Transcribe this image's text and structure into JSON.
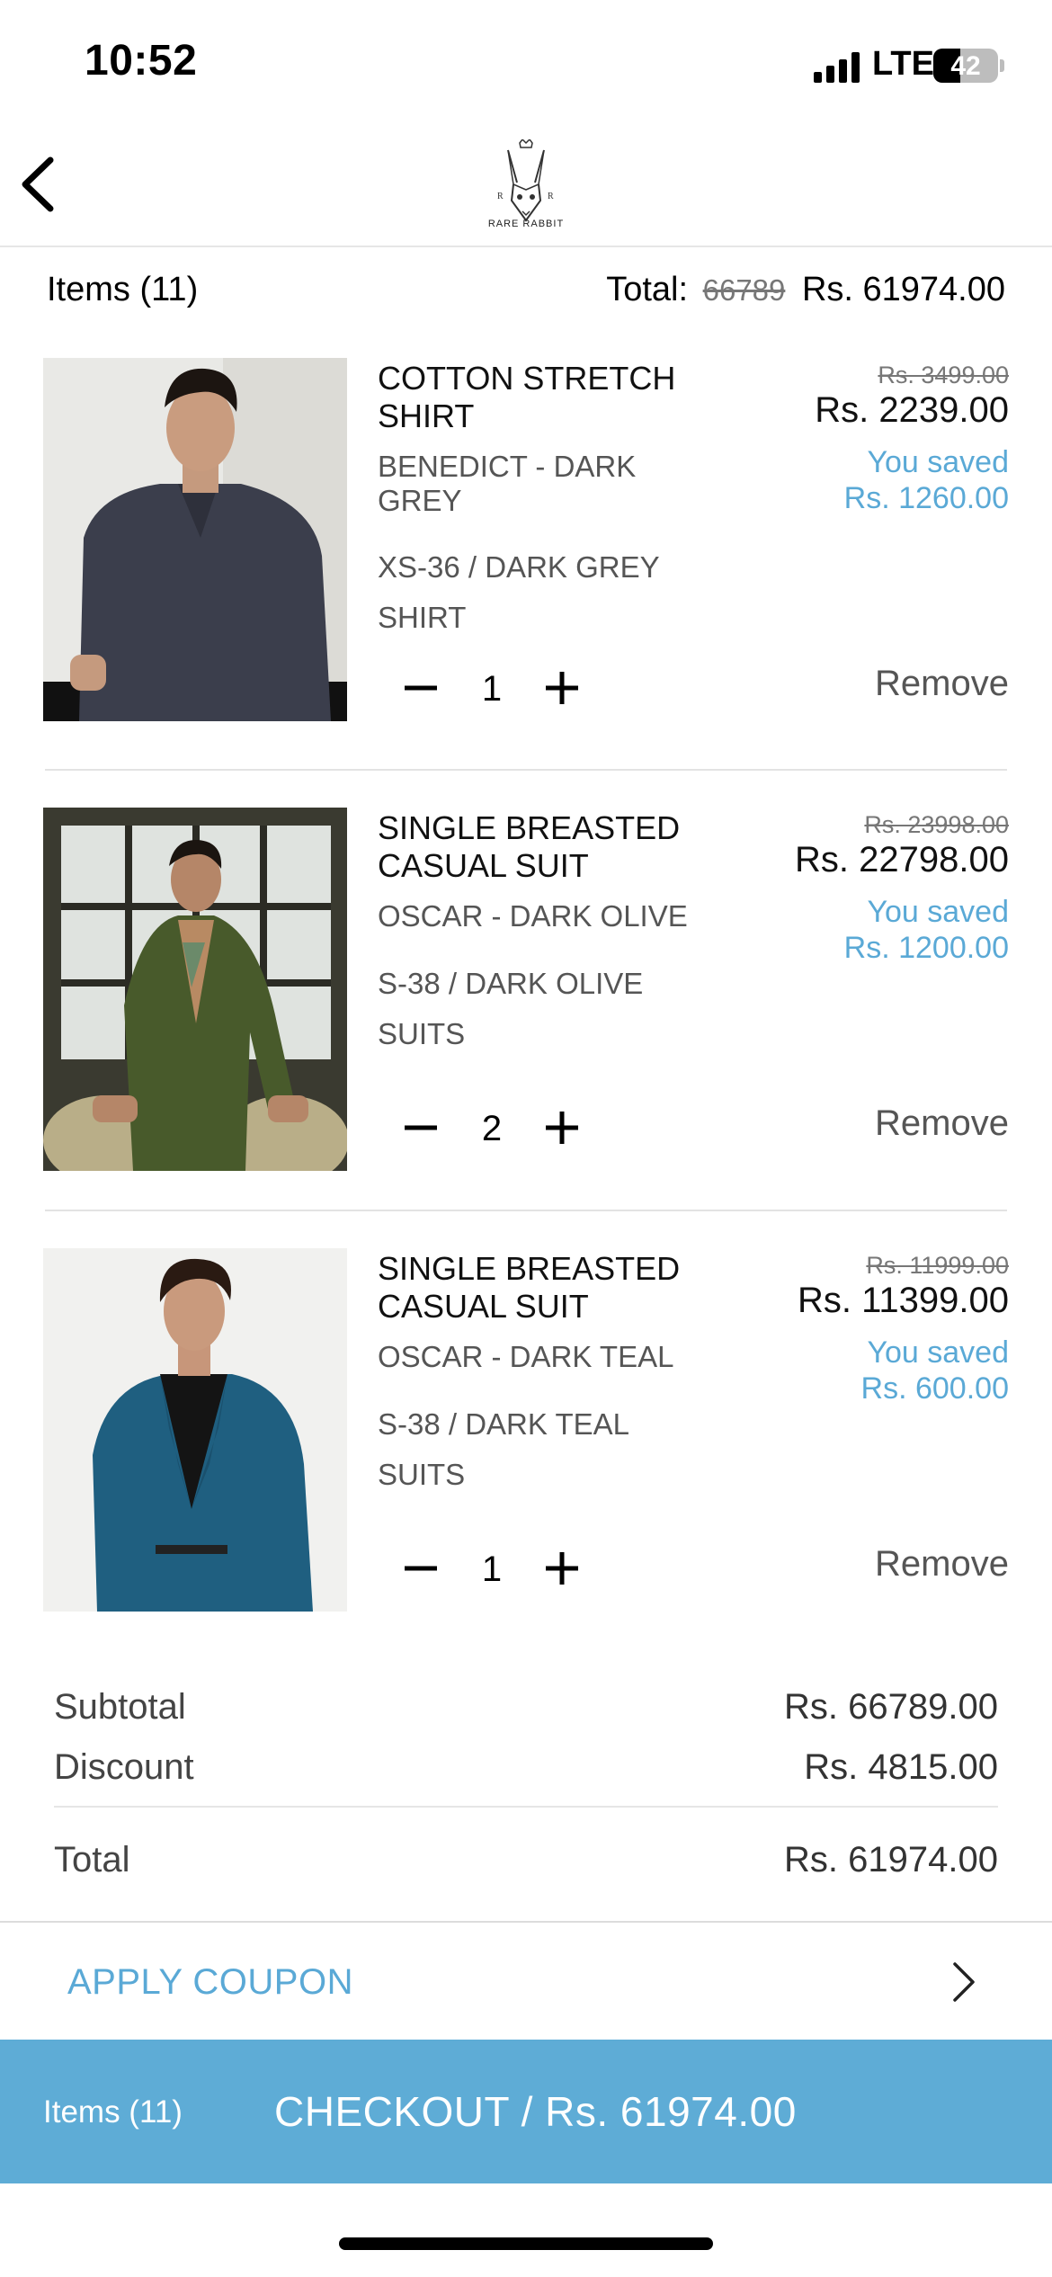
{
  "status_bar": {
    "time": "10:52",
    "network": "LTE",
    "battery_level": "42",
    "battery_fraction": 0.42
  },
  "header": {
    "brand": "RARE RABBIT"
  },
  "cart_summary": {
    "items_label": "Items (11)",
    "total_label": "Total:",
    "total_old": "66789",
    "total_new": "Rs. 61974.00"
  },
  "items": [
    {
      "name_line1": "COTTON STRETCH",
      "name_line2": "SHIRT",
      "variant_line1": "BENEDICT - DARK",
      "variant_line2": "GREY",
      "size": "XS-36 / DARK GREY",
      "category": "SHIRT",
      "price_old": "Rs. 3499.00",
      "price_new": "Rs. 2239.00",
      "saved_label": "You saved",
      "saved_amount": "Rs. 1260.00",
      "qty": "1",
      "remove_label": "Remove"
    },
    {
      "name_line1": "SINGLE BREASTED",
      "name_line2": "CASUAL SUIT",
      "variant_line1": "OSCAR - DARK OLIVE",
      "variant_line2": "",
      "size": "S-38 / DARK OLIVE",
      "category": "SUITS",
      "price_old": "Rs. 23998.00",
      "price_new": "Rs. 22798.00",
      "saved_label": "You saved",
      "saved_amount": "Rs. 1200.00",
      "qty": "2",
      "remove_label": "Remove"
    },
    {
      "name_line1": "SINGLE BREASTED",
      "name_line2": "CASUAL SUIT",
      "variant_line1": "OSCAR - DARK TEAL",
      "variant_line2": "",
      "size": "S-38 / DARK TEAL",
      "category": "SUITS",
      "price_old": "Rs. 11999.00",
      "price_new": "Rs. 11399.00",
      "saved_label": "You saved",
      "saved_amount": "Rs. 600.00",
      "qty": "1",
      "remove_label": "Remove"
    }
  ],
  "summary": {
    "subtotal_label": "Subtotal",
    "subtotal_value": "Rs. 66789.00",
    "discount_label": "Discount",
    "discount_value": "Rs. 4815.00",
    "total_label": "Total",
    "total_value": "Rs. 61974.00"
  },
  "coupon": {
    "label": "APPLY COUPON"
  },
  "checkout": {
    "items_label": "Items (11)",
    "label": "CHECKOUT / Rs. 61974.00"
  },
  "colors": {
    "accent": "#5eacd6",
    "saved_text": "#5aa9d6"
  }
}
